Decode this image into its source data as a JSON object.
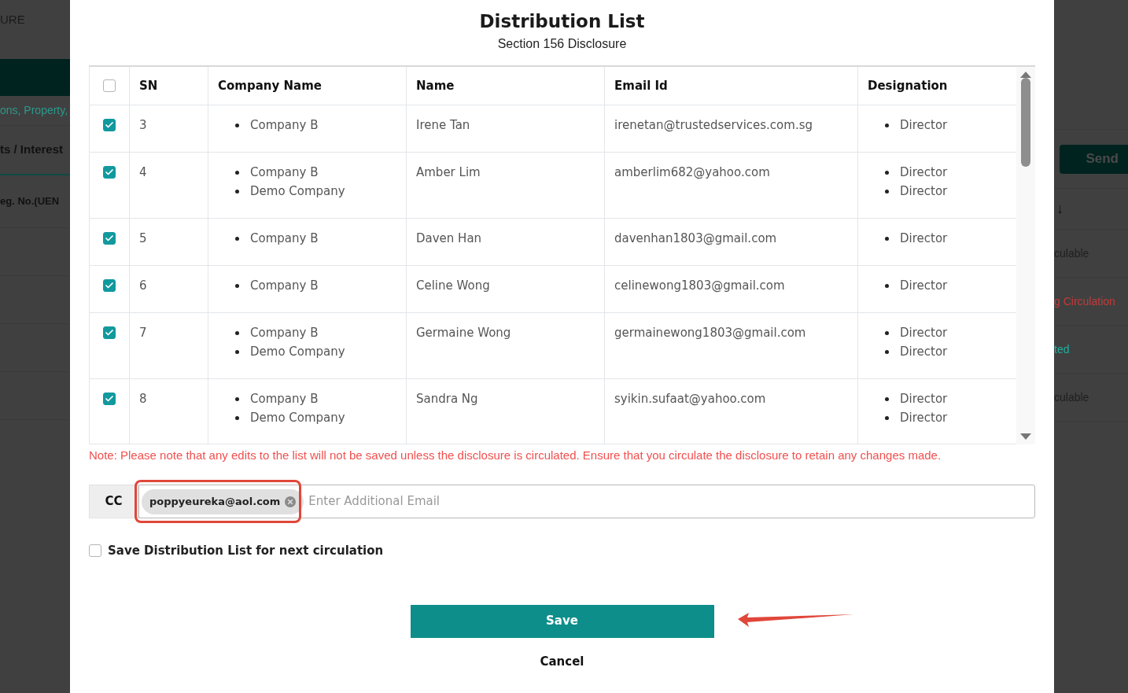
{
  "background": {
    "left": {
      "header": "URE",
      "breadcrumb": "ons, Property,",
      "tab": "ts / Interest",
      "column": "eg. No.(UEN"
    },
    "right": {
      "send_button": "Send",
      "sort_arrow": "↓",
      "statuses": [
        {
          "text": "culable",
          "color": "#1f1f1f"
        },
        {
          "text": "g Circulation",
          "color": "#c23a3a"
        },
        {
          "text": "ted",
          "color": "#1fb0a0"
        },
        {
          "text": "culable",
          "color": "#1f1f1f"
        }
      ]
    }
  },
  "dialog": {
    "title": "Distribution List",
    "subtitle": "Section 156 Disclosure",
    "table": {
      "all_checked": false,
      "columns": [
        "SN",
        "Company Name",
        "Name",
        "Email Id",
        "Designation"
      ],
      "rows": [
        {
          "checked": true,
          "sn": "3",
          "companies": [
            "Company B"
          ],
          "name": "Irene Tan",
          "email": "irenetan@trustedservices.com.sg",
          "designations": [
            "Director"
          ]
        },
        {
          "checked": true,
          "sn": "4",
          "companies": [
            "Company B",
            "Demo Company"
          ],
          "name": "Amber Lim",
          "email": "amberlim682@yahoo.com",
          "designations": [
            "Director",
            "Director"
          ]
        },
        {
          "checked": true,
          "sn": "5",
          "companies": [
            "Company B"
          ],
          "name": "Daven Han",
          "email": "davenhan1803@gmail.com",
          "designations": [
            "Director"
          ]
        },
        {
          "checked": true,
          "sn": "6",
          "companies": [
            "Company B"
          ],
          "name": "Celine Wong",
          "email": "celinewong1803@gmail.com",
          "designations": [
            "Director"
          ]
        },
        {
          "checked": true,
          "sn": "7",
          "companies": [
            "Company B",
            "Demo Company"
          ],
          "name": "Germaine Wong",
          "email": "germainewong1803@gmail.com",
          "designations": [
            "Director",
            "Director"
          ]
        },
        {
          "checked": true,
          "sn": "8",
          "companies": [
            "Company B",
            "Demo Company"
          ],
          "name": "Sandra Ng",
          "email": "syikin.sufaat@yahoo.com",
          "designations": [
            "Director",
            "Director"
          ]
        }
      ]
    },
    "note": "Note: Please note that any edits to the list will not be saved unless the disclosure is circulated. Ensure that you circulate the disclosure to retain any changes made.",
    "cc": {
      "label": "CC",
      "chips": [
        "poppyeureka@aol.com"
      ],
      "placeholder": "Enter Additional Email"
    },
    "save_list": {
      "label": "Save Distribution List for next circulation",
      "checked": false
    },
    "save_button": "Save",
    "cancel_button": "Cancel"
  }
}
